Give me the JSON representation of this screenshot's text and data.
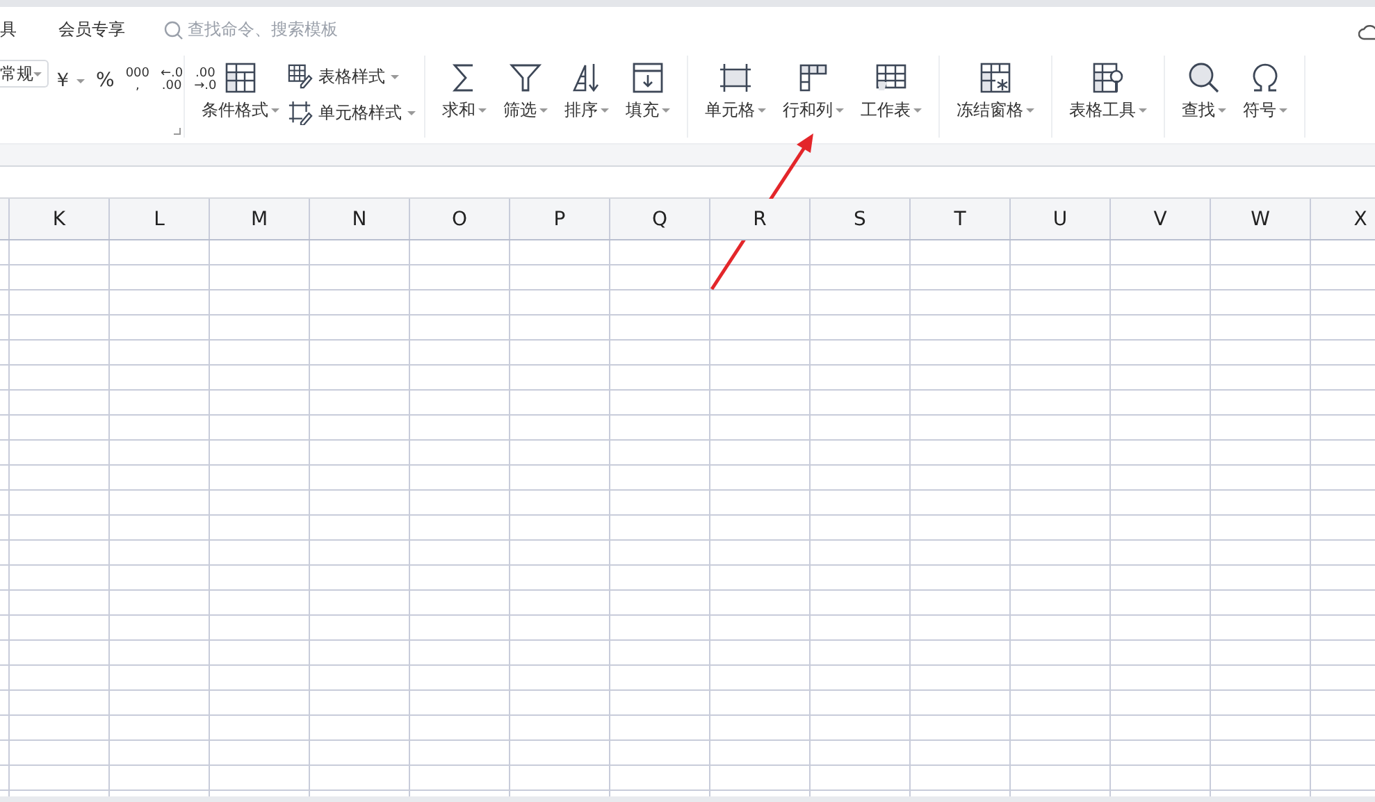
{
  "menu": {
    "tabs": [
      {
        "label": "具",
        "selected": false
      },
      {
        "label": "会员专享",
        "selected": false
      }
    ],
    "search": {
      "placeholder": "查找命令、搜索模板"
    }
  },
  "toolbar": {
    "number_format": {
      "value": "常规"
    },
    "format_buttons": [
      {
        "lines": [
          "￥"
        ],
        "dropdown": true
      },
      {
        "lines": [
          "%"
        ],
        "dropdown": false
      },
      {
        "lines": [
          "000",
          ","
        ],
        "dropdown": false
      },
      {
        "lines": [
          "←.0",
          ".00"
        ],
        "dropdown": false
      },
      {
        "lines": [
          ".00",
          "→.0"
        ],
        "dropdown": false
      }
    ],
    "groups": [
      {
        "items": [
          {
            "kind": "large",
            "label": "条件格式"
          },
          {
            "kind": "stack",
            "children": [
              {
                "label": "表格样式"
              },
              {
                "label": "单元格样式"
              }
            ]
          }
        ]
      },
      {
        "items": [
          {
            "kind": "large",
            "label": "求和"
          },
          {
            "kind": "large",
            "label": "筛选"
          },
          {
            "kind": "large",
            "label": "排序"
          },
          {
            "kind": "large",
            "label": "填充"
          }
        ]
      },
      {
        "items": [
          {
            "kind": "large",
            "label": "单元格"
          },
          {
            "kind": "large",
            "label": "行和列"
          },
          {
            "kind": "large",
            "label": "工作表"
          }
        ]
      },
      {
        "items": [
          {
            "kind": "large",
            "label": "冻结窗格"
          }
        ]
      },
      {
        "items": [
          {
            "kind": "large",
            "label": "表格工具"
          }
        ]
      },
      {
        "items": [
          {
            "kind": "large",
            "label": "查找"
          },
          {
            "kind": "large",
            "label": "符号"
          }
        ]
      }
    ]
  },
  "sheet": {
    "columns": [
      "",
      "K",
      "L",
      "M",
      "N",
      "O",
      "P",
      "Q",
      "R",
      "S",
      "T",
      "U",
      "V",
      "W",
      "X"
    ]
  }
}
